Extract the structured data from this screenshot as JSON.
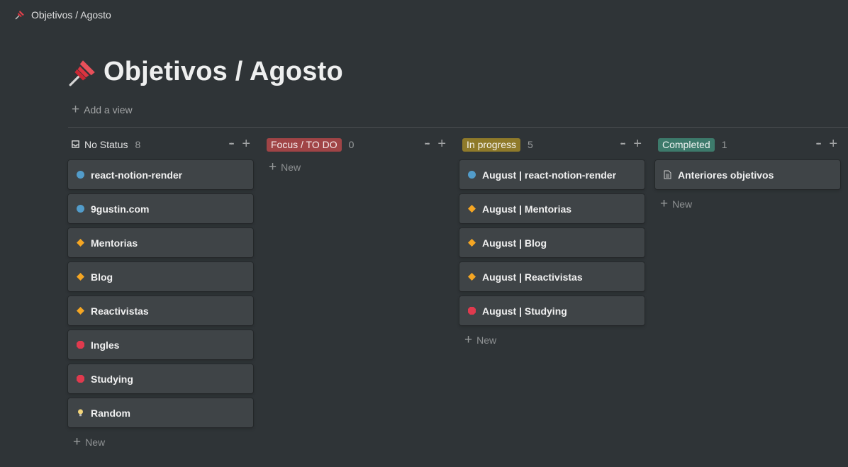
{
  "topbar": {
    "breadcrumb": "Objetivos / Agosto",
    "icon": "pushpin-icon"
  },
  "page": {
    "title": "Objetivos / Agosto",
    "icon": "pushpin-icon",
    "add_view": "Add a view"
  },
  "colors": {
    "background": "#2f3437",
    "card": "#3f4447",
    "focus_pill": "#a04446",
    "in_progress_pill": "#8f7a2a",
    "completed_pill": "#3d7a6b",
    "blue_circle": "#529cca",
    "orange_diamond": "#f5a623",
    "red_octagon": "#e03a4e"
  },
  "columns": [
    {
      "title": "No Status",
      "count": "8",
      "icon": "inbox-icon",
      "pill": false,
      "cards": [
        {
          "label": "react-notion-render",
          "icon": "blue-circle-icon"
        },
        {
          "label": "9gustin.com",
          "icon": "blue-circle-icon"
        },
        {
          "label": "Mentorias",
          "icon": "orange-diamond-icon"
        },
        {
          "label": "Blog",
          "icon": "orange-diamond-icon"
        },
        {
          "label": "Reactivistas",
          "icon": "orange-diamond-icon"
        },
        {
          "label": "Ingles",
          "icon": "red-octagon-icon"
        },
        {
          "label": "Studying",
          "icon": "red-octagon-icon"
        },
        {
          "label": "Random",
          "icon": "lightbulb-icon"
        }
      ],
      "new_label": "New"
    },
    {
      "title": "Focus / TO DO",
      "count": "0",
      "pill": true,
      "pill_color": "#a04446",
      "cards": [],
      "new_label": "New"
    },
    {
      "title": "In progress",
      "count": "5",
      "pill": true,
      "pill_color": "#8f7a2a",
      "cards": [
        {
          "label": "August | react-notion-render",
          "icon": "blue-circle-icon"
        },
        {
          "label": "August | Mentorias",
          "icon": "orange-diamond-icon"
        },
        {
          "label": "August | Blog",
          "icon": "orange-diamond-icon"
        },
        {
          "label": "August | Reactivistas",
          "icon": "orange-diamond-icon"
        },
        {
          "label": "August | Studying",
          "icon": "red-octagon-icon"
        }
      ],
      "new_label": "New"
    },
    {
      "title": "Completed",
      "count": "1",
      "pill": true,
      "pill_color": "#3d7a6b",
      "cards": [
        {
          "label": "Anteriores objetivos",
          "icon": "document-icon"
        }
      ],
      "new_label": "New"
    }
  ]
}
